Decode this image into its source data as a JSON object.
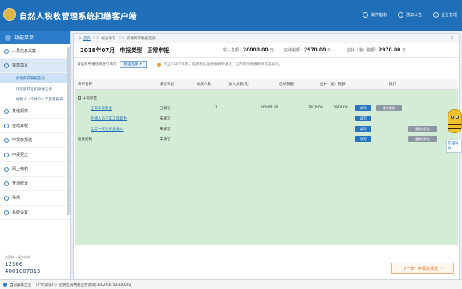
{
  "header": {
    "title": "自然人税收管理系统扣缴客户端",
    "actions": [
      {
        "icon": "operation-guide-icon",
        "label": "操作指南"
      },
      {
        "icon": "notification-icon",
        "label": "通知公告"
      },
      {
        "icon": "enterprise-settings-icon",
        "label": "企业管理"
      }
    ]
  },
  "sidebar": {
    "title": "功能菜单",
    "items": [
      {
        "label": "人员信息采集",
        "icon": "person-icon"
      },
      {
        "label": "报表填写",
        "icon": "form-icon",
        "active": true
      }
    ],
    "subitems": [
      {
        "label": "扣缴所得税报告表",
        "active": true
      },
      {
        "label": "限售股转让扣缴报告表"
      },
      {
        "label": "纳税人（个体户）年度申报表"
      }
    ],
    "more_items": [
      {
        "label": "其他报表",
        "icon": "other-icon"
      },
      {
        "label": "自动算税",
        "icon": "calc-icon"
      },
      {
        "label": "申报表报送",
        "icon": "send-icon"
      },
      {
        "label": "申报更正",
        "icon": "edit-icon"
      },
      {
        "label": "网上缴税",
        "icon": "payment-icon"
      },
      {
        "label": "查询统计",
        "icon": "stats-icon"
      },
      {
        "label": "事项",
        "icon": "matter-icon"
      },
      {
        "label": "系统设置",
        "icon": "settings-icon"
      }
    ],
    "hotline_label": "全国统一服务热线",
    "hotline_1": "12366",
    "hotline_2": "4001007815"
  },
  "breadcrumb": {
    "items": [
      "首页",
      "报表填写",
      "扣缴所得税报告表"
    ],
    "separator": ">>"
  },
  "info": {
    "period": "2018年07月",
    "type_label": "申报类型",
    "type_value": "正常申报",
    "income_label": "收入总额",
    "income_value": "20000.00",
    "income_unit": "元",
    "tax_label": "应纳税额",
    "tax_value": "2970.00",
    "tax_unit": "元",
    "refund_label": "应补（退）税额",
    "refund_value": "2970.00",
    "refund_unit": "元"
  },
  "toolbar": {
    "label": "请选择申报项目进行填写",
    "select_value": "管理选择",
    "tip": "只显示填写项目，选择在此填报报表单填写，无所得项目报表单无需填写。"
  },
  "table": {
    "columns": [
      "表单名称",
      "填写状态",
      "纳税人数",
      "收入总额(元)",
      "应纳税额",
      "应补（退）税额",
      "操作"
    ],
    "rows": [
      {
        "name": "工资薪金",
        "is_group": true,
        "status": "",
        "count": "",
        "income": "",
        "tax": "",
        "refund": "",
        "actions": []
      },
      {
        "name": "正常工资薪金",
        "is_link": true,
        "status": "已填写",
        "count": "1",
        "income": "20000.00",
        "tax": "2970.00",
        "refund": "2970.00",
        "actions": [
          "填写",
          "清空数据"
        ]
      },
      {
        "name": "外籍人员正常工资薪金",
        "is_link": true,
        "status": "未填写",
        "count": "",
        "income": "",
        "tax": "",
        "refund": "",
        "actions": [
          "填写"
        ]
      },
      {
        "name": "全年一次性奖金收入",
        "is_link": true,
        "status": "未填写",
        "count": "",
        "income": "",
        "tax": "",
        "refund": "",
        "actions": [
          "填写",
          "删除/添加"
        ]
      },
      {
        "name": "股息红利",
        "is_group": true,
        "status": "未填写",
        "count": "",
        "income": "",
        "tax": "",
        "refund": "",
        "actions": [
          "填写",
          "删除/添加"
        ]
      }
    ]
  },
  "footer": {
    "next_label": "下一步",
    "next_sub": "申报表报送"
  },
  "statusbar": {
    "label": "当前操作企业",
    "value": "（个体测试户）范明区局纳税业务测试[350203C50300002]"
  },
  "assistant": {
    "label": "在线导办"
  }
}
